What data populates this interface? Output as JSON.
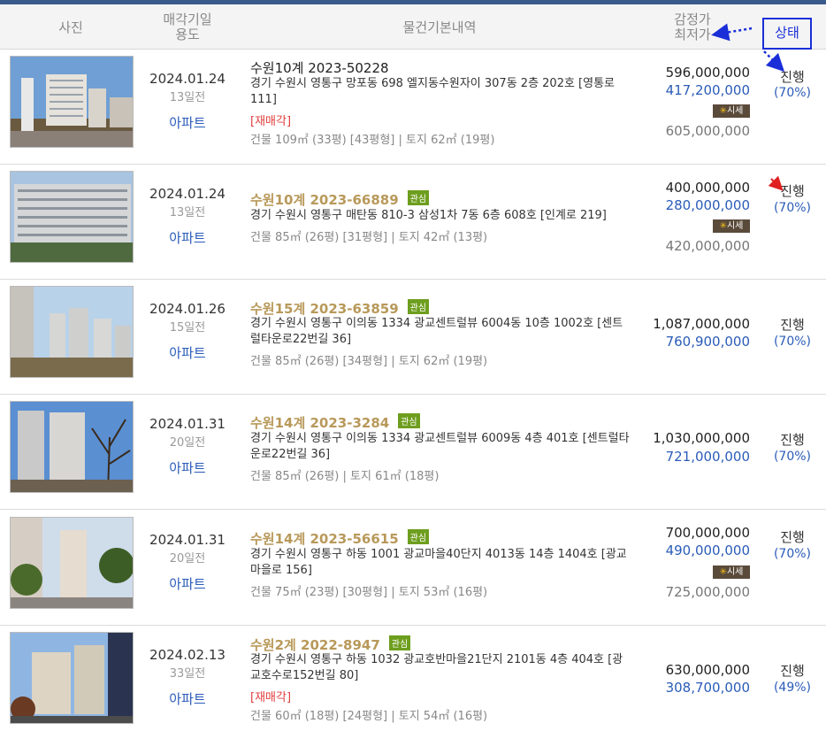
{
  "header": {
    "photo": "사진",
    "date_line1": "매각기일",
    "date_line2": "용도",
    "info": "물건기본내역",
    "price_line1": "감정가",
    "price_line2": "최저가",
    "status": "상태"
  },
  "market_badge": {
    "icon": "✳",
    "label": "시세"
  },
  "rows": [
    {
      "date": "2024.01.24",
      "ago": "13일전",
      "usage": "아파트",
      "case": "수원10계 2023-50228",
      "interest": "",
      "address": "경기 수원시 영통구 망포동 698 엘지동수원자이 307동 2층 202호 [영통로 111]",
      "resale": "[재매각]",
      "area": "건물 109㎡ (33평) [43평형]  |  토지 62㎡ (19평)",
      "appraisal": "596,000,000",
      "minimum": "417,200,000",
      "market_price": "605,000,000",
      "status": "진행",
      "percent": "(70%)"
    },
    {
      "date": "2024.01.24",
      "ago": "13일전",
      "usage": "아파트",
      "case": "수원10계 2023-66889",
      "interest": "관심",
      "address": "경기 수원시 영통구 매탄동 810-3 삼성1차 7동 6층 608호 [인계로 219]",
      "resale": "",
      "area": "건물 85㎡ (26평) [31평형]  |  토지 42㎡ (13평)",
      "appraisal": "400,000,000",
      "minimum": "280,000,000",
      "market_price": "420,000,000",
      "status": "진행",
      "percent": "(70%)"
    },
    {
      "date": "2024.01.26",
      "ago": "15일전",
      "usage": "아파트",
      "case": "수원15계 2023-63859",
      "interest": "관심",
      "address": "경기 수원시 영통구 이의동 1334 광교센트럴뷰 6004동 10층 1002호 [센트럴타운로22번길 36]",
      "resale": "",
      "area": "건물 85㎡ (26평) [34평형]  |  토지 62㎡ (19평)",
      "appraisal": "1,087,000,000",
      "minimum": "760,900,000",
      "market_price": "",
      "status": "진행",
      "percent": "(70%)"
    },
    {
      "date": "2024.01.31",
      "ago": "20일전",
      "usage": "아파트",
      "case": "수원14계 2023-3284",
      "interest": "관심",
      "address": "경기 수원시 영통구 이의동 1334 광교센트럴뷰 6009동 4층 401호 [센트럴타운로22번길 36]",
      "resale": "",
      "area": "건물 85㎡ (26평)  |  토지 61㎡ (18평)",
      "appraisal": "1,030,000,000",
      "minimum": "721,000,000",
      "market_price": "",
      "status": "진행",
      "percent": "(70%)"
    },
    {
      "date": "2024.01.31",
      "ago": "20일전",
      "usage": "아파트",
      "case": "수원14계 2023-56615",
      "interest": "관심",
      "address": "경기 수원시 영통구 하동 1001 광교마을40단지 4013동 14층 1404호 [광교마을로 156]",
      "resale": "",
      "area": "건물 75㎡ (23평) [30평형]  |  토지 53㎡ (16평)",
      "appraisal": "700,000,000",
      "minimum": "490,000,000",
      "market_price": "725,000,000",
      "status": "진행",
      "percent": "(70%)"
    },
    {
      "date": "2024.02.13",
      "ago": "33일전",
      "usage": "아파트",
      "case": "수원2계 2022-8947",
      "interest": "관심",
      "address": "경기 수원시 영통구 하동 1032 광교호반마을21단지 2101동 4층 404호 [광교호수로152번길 80]",
      "resale": "[재매각]",
      "area": "건물 60㎡ (18평) [24평형]  |  토지 54㎡ (16평)",
      "appraisal": "630,000,000",
      "minimum": "308,700,000",
      "market_price": "",
      "status": "진행",
      "percent": "(49%)"
    }
  ]
}
